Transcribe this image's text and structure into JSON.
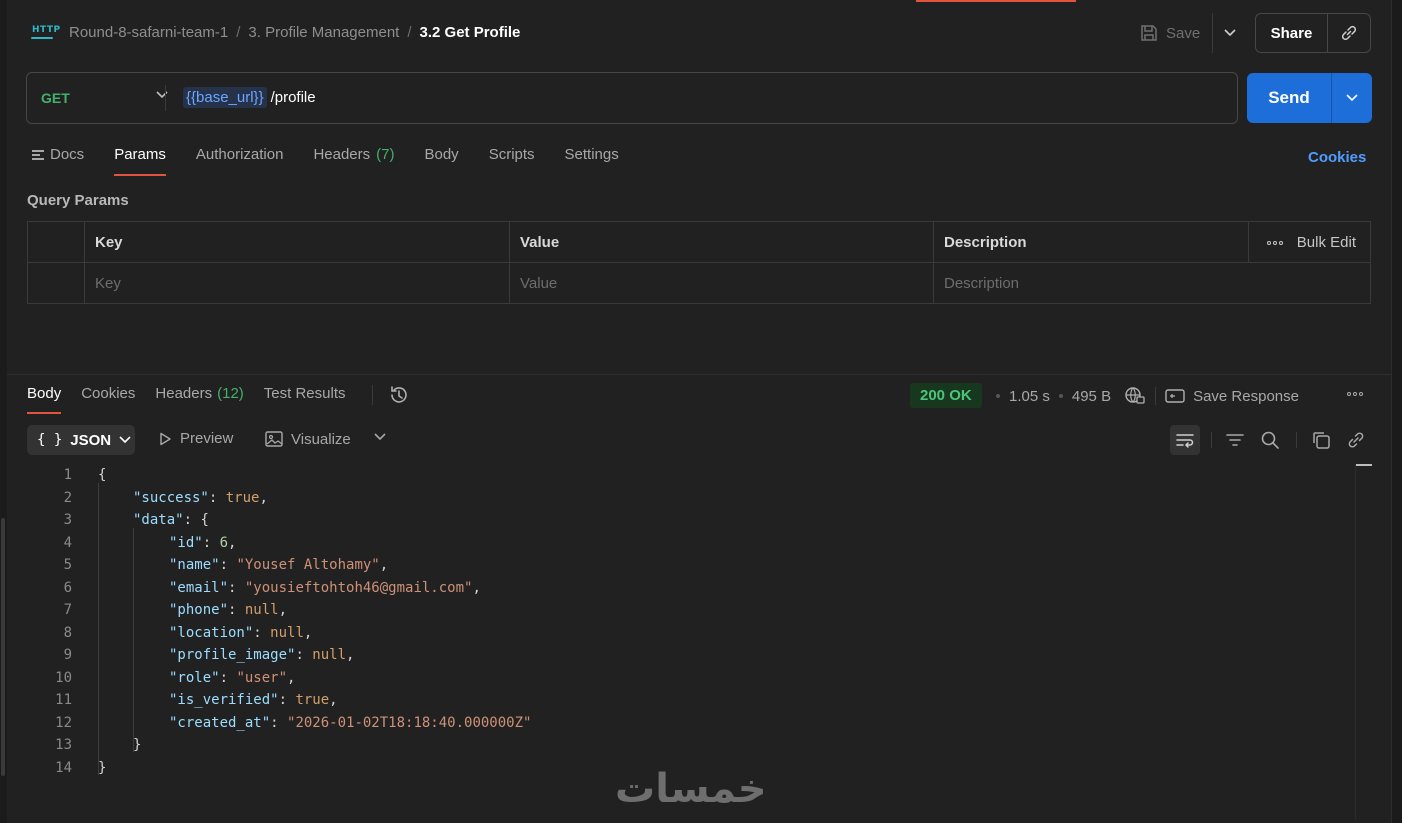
{
  "header": {
    "http_icon_label": "HTTP",
    "breadcrumbs": [
      "Round-8-safarni-team-1",
      "3. Profile Management",
      "3.2 Get Profile"
    ],
    "separator": "/",
    "save_label": "Save",
    "share_label": "Share"
  },
  "request": {
    "method": "GET",
    "url_variable": "{{base_url}}",
    "url_path": "/profile",
    "send_label": "Send"
  },
  "request_tabs": {
    "docs": "Docs",
    "params": "Params",
    "authorization": "Authorization",
    "headers": "Headers",
    "headers_count": "(7)",
    "body": "Body",
    "scripts": "Scripts",
    "settings": "Settings",
    "cookies": "Cookies"
  },
  "query_params": {
    "title": "Query Params",
    "columns": [
      "Key",
      "Value",
      "Description"
    ],
    "placeholders": [
      "Key",
      "Value",
      "Description"
    ],
    "bulk_edit": "Bulk Edit"
  },
  "response_tabs": {
    "body": "Body",
    "cookies": "Cookies",
    "headers": "Headers",
    "headers_count": "(12)",
    "test_results": "Test Results"
  },
  "response_meta": {
    "status": "200 OK",
    "time": "1.05 s",
    "size": "495 B",
    "save_response": "Save Response"
  },
  "response_toolbar": {
    "format": "JSON",
    "format_braces": "{ }",
    "preview": "Preview",
    "visualize": "Visualize"
  },
  "code": {
    "line_numbers": [
      "1",
      "2",
      "3",
      "4",
      "5",
      "6",
      "7",
      "8",
      "9",
      "10",
      "11",
      "12",
      "13",
      "14"
    ],
    "open_brace": "{",
    "close_brace": "}",
    "success_key": "\"success\"",
    "success_value": "true",
    "data_key": "\"data\"",
    "fields": [
      {
        "key": "\"id\"",
        "value": "6",
        "kind": "n"
      },
      {
        "key": "\"name\"",
        "value": "\"Yousef Altohamy\"",
        "kind": "s"
      },
      {
        "key": "\"email\"",
        "value": "\"yousieftohtoh46@gmail.com\"",
        "kind": "s"
      },
      {
        "key": "\"phone\"",
        "value": "null",
        "kind": "lit"
      },
      {
        "key": "\"location\"",
        "value": "null",
        "kind": "lit"
      },
      {
        "key": "\"profile_image\"",
        "value": "null",
        "kind": "lit"
      },
      {
        "key": "\"role\"",
        "value": "\"user\"",
        "kind": "s"
      },
      {
        "key": "\"is_verified\"",
        "value": "true",
        "kind": "lit"
      },
      {
        "key": "\"created_at\"",
        "value": "\"2026-01-02T18:18:40.000000Z\"",
        "kind": "s"
      }
    ]
  },
  "watermark": "خمسات",
  "colors": {
    "accent": "#e0553b",
    "send": "#1d6ed8",
    "method_get": "#43b06c",
    "status_ok": "#4cc47a",
    "link": "#4f9dff"
  }
}
